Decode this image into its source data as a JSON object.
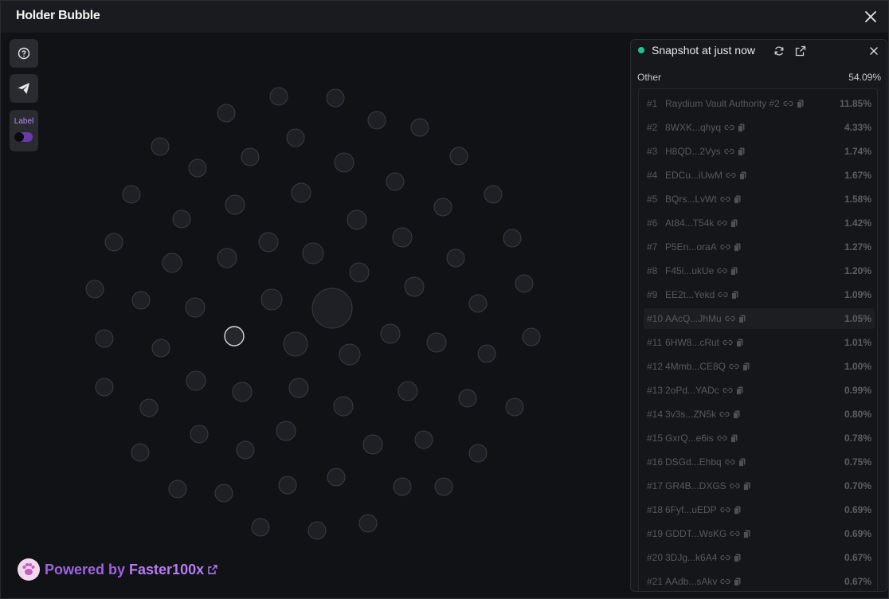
{
  "window": {
    "title": "Holder Bubble",
    "close_icon": "close-icon"
  },
  "toolbar": {
    "help_icon": "help-circle-icon",
    "telegram_icon": "telegram-send-icon",
    "label_text": "Label",
    "label_toggle_on": false
  },
  "footer": {
    "powered_text": "Powered by",
    "brand": "Faster100x",
    "external_icon": "external-link-icon"
  },
  "panel": {
    "snapshot_title": "Snapshot at just now",
    "status_color": "#1fc48c",
    "refresh_icon": "refresh-icon",
    "open_icon": "external-link-icon",
    "close_icon": "close-icon",
    "other_label": "Other",
    "other_pct": "54.09%",
    "holders": [
      {
        "rank": "#1",
        "name": "Raydium Vault Authority #2",
        "pct": "11.85%"
      },
      {
        "rank": "#2",
        "name": "8WXK...qhyq",
        "pct": "4.33%"
      },
      {
        "rank": "#3",
        "name": "H8QD...2Vys",
        "pct": "1.74%"
      },
      {
        "rank": "#4",
        "name": "EDCu...iUwM",
        "pct": "1.67%"
      },
      {
        "rank": "#5",
        "name": "BQrs...LvWt",
        "pct": "1.58%"
      },
      {
        "rank": "#6",
        "name": "At84...T54k",
        "pct": "1.42%"
      },
      {
        "rank": "#7",
        "name": "P5En...oraA",
        "pct": "1.27%"
      },
      {
        "rank": "#8",
        "name": "F45i...ukUe",
        "pct": "1.20%"
      },
      {
        "rank": "#9",
        "name": "EE2t...Yekd",
        "pct": "1.09%"
      },
      {
        "rank": "#10",
        "name": "AAcQ...JhMu",
        "pct": "1.05%"
      },
      {
        "rank": "#11",
        "name": "6HW8...cRut",
        "pct": "1.01%"
      },
      {
        "rank": "#12",
        "name": "4Mmb...CE8Q",
        "pct": "1.00%"
      },
      {
        "rank": "#13",
        "name": "2oPd...YADc",
        "pct": "0.99%"
      },
      {
        "rank": "#14",
        "name": "3v3s...ZN5k",
        "pct": "0.80%"
      },
      {
        "rank": "#15",
        "name": "GxrQ...e6is",
        "pct": "0.78%"
      },
      {
        "rank": "#16",
        "name": "DSGd...Ehbq",
        "pct": "0.75%"
      },
      {
        "rank": "#17",
        "name": "GR4B...DXGS",
        "pct": "0.70%"
      },
      {
        "rank": "#18",
        "name": "6Fyf...uEDP",
        "pct": "0.69%"
      },
      {
        "rank": "#19",
        "name": "GDDT...WsKG",
        "pct": "0.69%"
      },
      {
        "rank": "#20",
        "name": "3DJg...k6A4",
        "pct": "0.67%"
      },
      {
        "rank": "#21",
        "name": "AAdb...sAkv",
        "pct": "0.67%"
      }
    ],
    "link_icon": "link-icon",
    "copy_icon": "copy-icon"
  }
}
